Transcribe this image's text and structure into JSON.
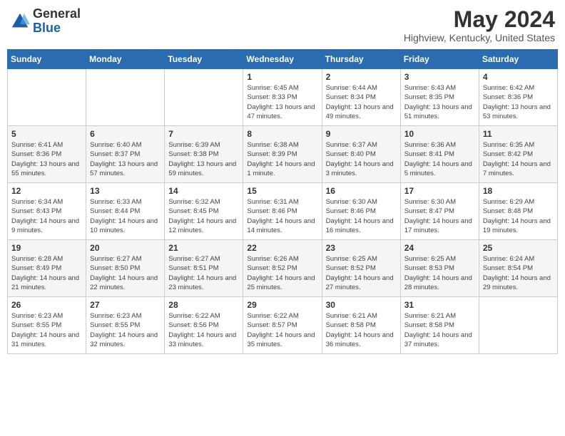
{
  "logo": {
    "general": "General",
    "blue": "Blue"
  },
  "title": {
    "month_year": "May 2024",
    "location": "Highview, Kentucky, United States"
  },
  "days_of_week": [
    "Sunday",
    "Monday",
    "Tuesday",
    "Wednesday",
    "Thursday",
    "Friday",
    "Saturday"
  ],
  "weeks": [
    [
      {
        "day": "",
        "info": ""
      },
      {
        "day": "",
        "info": ""
      },
      {
        "day": "",
        "info": ""
      },
      {
        "day": "1",
        "info": "Sunrise: 6:45 AM\nSunset: 8:33 PM\nDaylight: 13 hours and 47 minutes."
      },
      {
        "day": "2",
        "info": "Sunrise: 6:44 AM\nSunset: 8:34 PM\nDaylight: 13 hours and 49 minutes."
      },
      {
        "day": "3",
        "info": "Sunrise: 6:43 AM\nSunset: 8:35 PM\nDaylight: 13 hours and 51 minutes."
      },
      {
        "day": "4",
        "info": "Sunrise: 6:42 AM\nSunset: 8:36 PM\nDaylight: 13 hours and 53 minutes."
      }
    ],
    [
      {
        "day": "5",
        "info": "Sunrise: 6:41 AM\nSunset: 8:36 PM\nDaylight: 13 hours and 55 minutes."
      },
      {
        "day": "6",
        "info": "Sunrise: 6:40 AM\nSunset: 8:37 PM\nDaylight: 13 hours and 57 minutes."
      },
      {
        "day": "7",
        "info": "Sunrise: 6:39 AM\nSunset: 8:38 PM\nDaylight: 13 hours and 59 minutes."
      },
      {
        "day": "8",
        "info": "Sunrise: 6:38 AM\nSunset: 8:39 PM\nDaylight: 14 hours and 1 minute."
      },
      {
        "day": "9",
        "info": "Sunrise: 6:37 AM\nSunset: 8:40 PM\nDaylight: 14 hours and 3 minutes."
      },
      {
        "day": "10",
        "info": "Sunrise: 6:36 AM\nSunset: 8:41 PM\nDaylight: 14 hours and 5 minutes."
      },
      {
        "day": "11",
        "info": "Sunrise: 6:35 AM\nSunset: 8:42 PM\nDaylight: 14 hours and 7 minutes."
      }
    ],
    [
      {
        "day": "12",
        "info": "Sunrise: 6:34 AM\nSunset: 8:43 PM\nDaylight: 14 hours and 9 minutes."
      },
      {
        "day": "13",
        "info": "Sunrise: 6:33 AM\nSunset: 8:44 PM\nDaylight: 14 hours and 10 minutes."
      },
      {
        "day": "14",
        "info": "Sunrise: 6:32 AM\nSunset: 8:45 PM\nDaylight: 14 hours and 12 minutes."
      },
      {
        "day": "15",
        "info": "Sunrise: 6:31 AM\nSunset: 8:46 PM\nDaylight: 14 hours and 14 minutes."
      },
      {
        "day": "16",
        "info": "Sunrise: 6:30 AM\nSunset: 8:46 PM\nDaylight: 14 hours and 16 minutes."
      },
      {
        "day": "17",
        "info": "Sunrise: 6:30 AM\nSunset: 8:47 PM\nDaylight: 14 hours and 17 minutes."
      },
      {
        "day": "18",
        "info": "Sunrise: 6:29 AM\nSunset: 8:48 PM\nDaylight: 14 hours and 19 minutes."
      }
    ],
    [
      {
        "day": "19",
        "info": "Sunrise: 6:28 AM\nSunset: 8:49 PM\nDaylight: 14 hours and 21 minutes."
      },
      {
        "day": "20",
        "info": "Sunrise: 6:27 AM\nSunset: 8:50 PM\nDaylight: 14 hours and 22 minutes."
      },
      {
        "day": "21",
        "info": "Sunrise: 6:27 AM\nSunset: 8:51 PM\nDaylight: 14 hours and 23 minutes."
      },
      {
        "day": "22",
        "info": "Sunrise: 6:26 AM\nSunset: 8:52 PM\nDaylight: 14 hours and 25 minutes."
      },
      {
        "day": "23",
        "info": "Sunrise: 6:25 AM\nSunset: 8:52 PM\nDaylight: 14 hours and 27 minutes."
      },
      {
        "day": "24",
        "info": "Sunrise: 6:25 AM\nSunset: 8:53 PM\nDaylight: 14 hours and 28 minutes."
      },
      {
        "day": "25",
        "info": "Sunrise: 6:24 AM\nSunset: 8:54 PM\nDaylight: 14 hours and 29 minutes."
      }
    ],
    [
      {
        "day": "26",
        "info": "Sunrise: 6:23 AM\nSunset: 8:55 PM\nDaylight: 14 hours and 31 minutes."
      },
      {
        "day": "27",
        "info": "Sunrise: 6:23 AM\nSunset: 8:55 PM\nDaylight: 14 hours and 32 minutes."
      },
      {
        "day": "28",
        "info": "Sunrise: 6:22 AM\nSunset: 8:56 PM\nDaylight: 14 hours and 33 minutes."
      },
      {
        "day": "29",
        "info": "Sunrise: 6:22 AM\nSunset: 8:57 PM\nDaylight: 14 hours and 35 minutes."
      },
      {
        "day": "30",
        "info": "Sunrise: 6:21 AM\nSunset: 8:58 PM\nDaylight: 14 hours and 36 minutes."
      },
      {
        "day": "31",
        "info": "Sunrise: 6:21 AM\nSunset: 8:58 PM\nDaylight: 14 hours and 37 minutes."
      },
      {
        "day": "",
        "info": ""
      }
    ]
  ]
}
